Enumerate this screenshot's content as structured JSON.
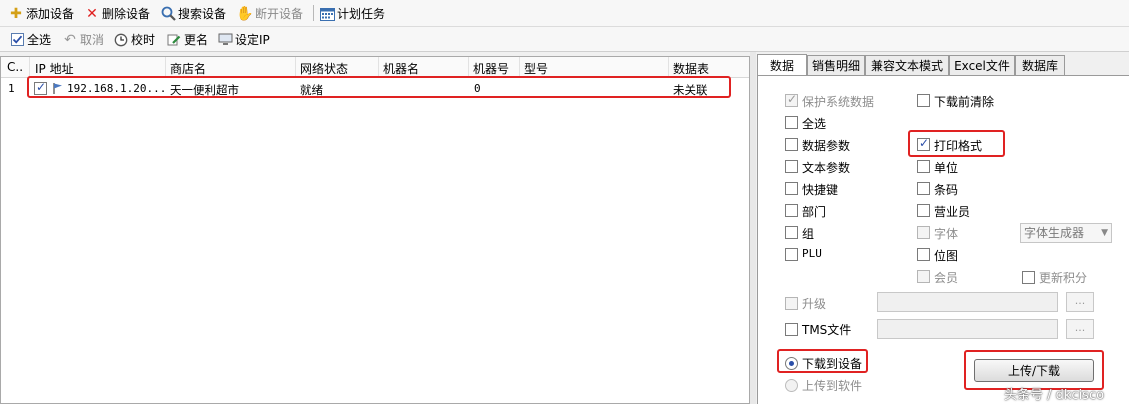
{
  "toolbar1": {
    "add_device": "添加设备",
    "delete_device": "删除设备",
    "search_device": "搜索设备",
    "disconnect_device": "断开设备",
    "scheduled_task": "计划任务"
  },
  "toolbar2": {
    "select_all": "全选",
    "cancel": "取消",
    "sync_time": "校时",
    "rename": "更名",
    "set_ip": "设定IP"
  },
  "grid": {
    "columns": [
      "C..",
      "IP 地址",
      "商店名",
      "网络状态",
      "机器名",
      "机器号",
      "型号",
      "数据表"
    ],
    "rows": [
      {
        "index": "1",
        "ip": "192.168.1.20...",
        "store": "天一便利超市",
        "status": "就绪",
        "machine_name": "",
        "machine_no": "0",
        "model": "",
        "table": "未关联"
      }
    ]
  },
  "tabs": [
    "数据",
    "销售明细",
    "兼容文本模式",
    "Excel文件",
    "数据库"
  ],
  "options": {
    "protect_system_data": "保护系统数据",
    "clear_before_download": "下载前清除",
    "select_all": "全选",
    "data_params": "数据参数",
    "print_format": "打印格式",
    "text_params": "文本参数",
    "unit": "单位",
    "shortcut_keys": "快捷键",
    "barcode": "条码",
    "department": "部门",
    "salesperson": "营业员",
    "group": "组",
    "font": "字体",
    "font_generator": "字体生成器",
    "plu": "PLU",
    "bitmap": "位图",
    "member": "会员",
    "update_points": "更新积分",
    "upgrade": "升级",
    "tms_file": "TMS文件",
    "browse": "...",
    "download_to_device": "下载到设备",
    "upload_to_software": "上传到软件",
    "upload_download_button": "上传/下载"
  },
  "watermark": "头条号 / dkcisco",
  "colors": {
    "highlight": "#e02222",
    "check": "#2a4ea8"
  }
}
